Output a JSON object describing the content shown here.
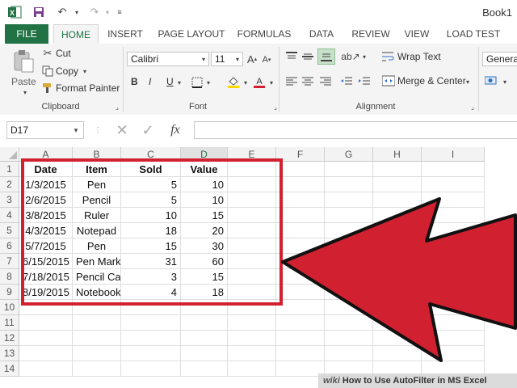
{
  "window": {
    "title": "Book1"
  },
  "tabs": [
    "FILE",
    "HOME",
    "INSERT",
    "PAGE LAYOUT",
    "FORMULAS",
    "DATA",
    "REVIEW",
    "VIEW",
    "LOAD TEST"
  ],
  "ribbon": {
    "clipboard": {
      "paste": "Paste",
      "cut": "Cut",
      "copy": "Copy",
      "format_painter": "Format Painter",
      "label": "Clipboard"
    },
    "font": {
      "name": "Calibri",
      "size": "11",
      "label": "Font",
      "bold": "B",
      "italic": "I",
      "underline": "U"
    },
    "alignment": {
      "wrap_text": "Wrap Text",
      "merge_center": "Merge & Center",
      "label": "Alignment"
    },
    "number": {
      "format": "General"
    }
  },
  "formula_bar": {
    "name_box": "D17",
    "fx": "fx",
    "value": ""
  },
  "sheet": {
    "columns": [
      "A",
      "B",
      "C",
      "D",
      "E",
      "F",
      "G",
      "H",
      "I"
    ],
    "selected_column": "D",
    "rows": [
      "1",
      "2",
      "3",
      "4",
      "5",
      "6",
      "7",
      "8",
      "9",
      "10",
      "11",
      "12",
      "13",
      "14"
    ],
    "headers": [
      "Date",
      "Item",
      "Sold",
      "Value"
    ],
    "data": [
      [
        "1/3/2015",
        "Pen",
        "5",
        "10"
      ],
      [
        "2/6/2015",
        "Pencil",
        "5",
        "10"
      ],
      [
        "3/8/2015",
        "Ruler",
        "10",
        "15"
      ],
      [
        "4/3/2015",
        "Notepad",
        "18",
        "20"
      ],
      [
        "5/7/2015",
        "Pen",
        "15",
        "30"
      ],
      [
        "6/15/2015",
        "Pen Marker",
        "31",
        "60"
      ],
      [
        "7/18/2015",
        "Pencil Case",
        "3",
        "15"
      ],
      [
        "8/19/2015",
        "Notebook",
        "4",
        "18"
      ]
    ]
  },
  "watermark": {
    "prefix": "wiki",
    "text": "How to Use AutoFilter in MS Excel"
  },
  "colors": {
    "excel_green": "#217346",
    "highlight_red": "#d1202f"
  }
}
